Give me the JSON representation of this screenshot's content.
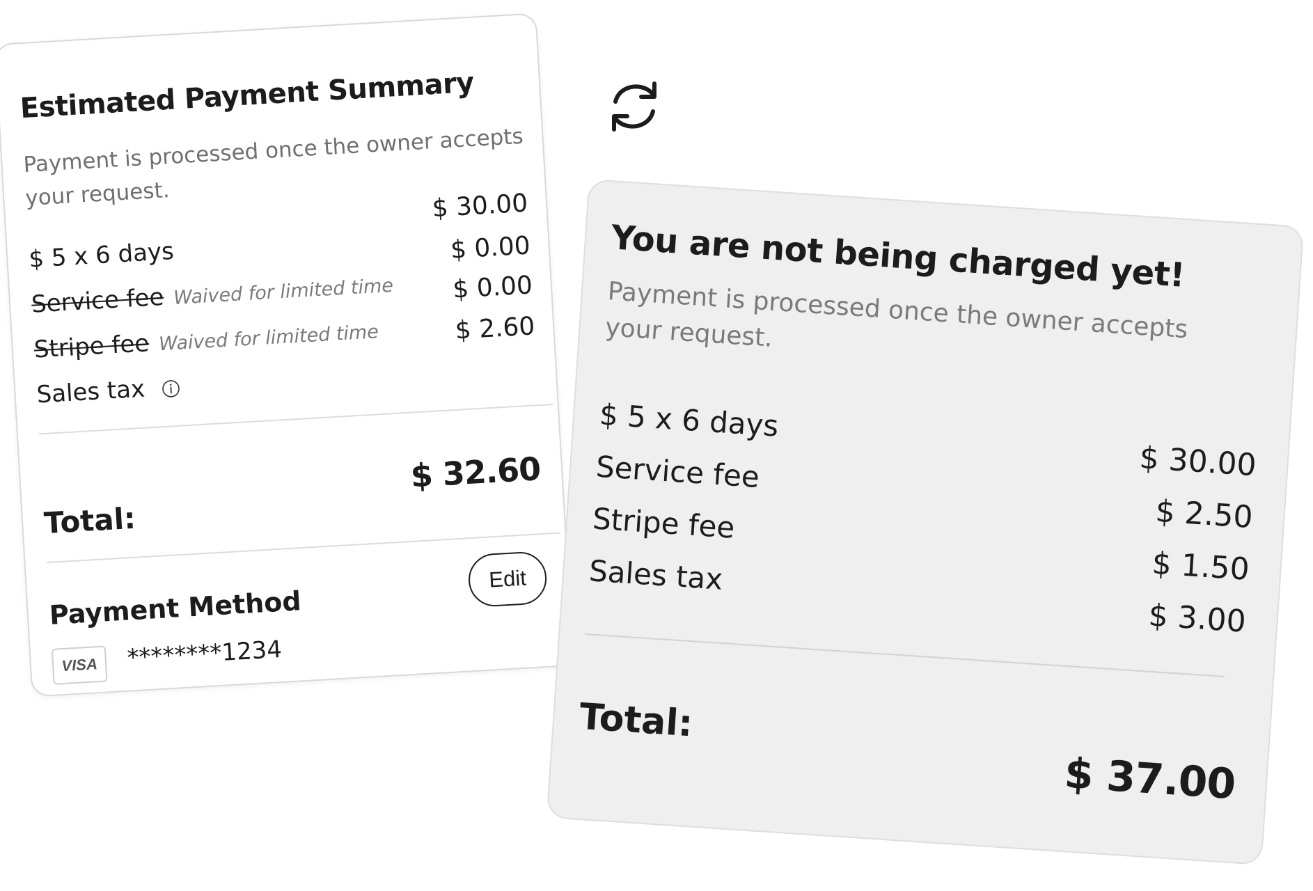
{
  "estimate_card": {
    "title": "Estimated Payment Summary",
    "subtitle": "Payment is processed once the owner accepts your request.",
    "rows": [
      {
        "label": "$ 5 x 6 days",
        "note": "",
        "amount": "$ 30.00",
        "struck": false
      },
      {
        "label": "Service fee",
        "note": "Waived for limited time",
        "amount": "$ 0.00",
        "struck": true
      },
      {
        "label": "Stripe fee",
        "note": "Waived for limited time",
        "amount": "$ 0.00",
        "struck": true
      },
      {
        "label": "Sales tax",
        "note": "",
        "amount": "$ 2.60",
        "struck": false
      }
    ],
    "total_label": "Total:",
    "total_amount": "$ 32.60",
    "payment_method_title": "Payment Method",
    "edit_label": "Edit",
    "card_brand": "VISA",
    "card_number": "********1234",
    "icons": {
      "sales_tax_info": "info-icon"
    }
  },
  "swap_icon": "refresh-icon",
  "charge_card": {
    "title": "You are not being charged yet!",
    "subtitle": "Payment is processed once the owner accepts your request.",
    "labels": [
      "$ 5 x 6 days",
      "Service fee",
      "Stripe fee",
      "Sales tax"
    ],
    "amounts": [
      "$ 30.00",
      "$ 2.50",
      "$ 1.50",
      "$ 3.00"
    ],
    "total_label": "Total:",
    "total_amount": "$ 37.00"
  },
  "colors": {
    "text": "#1c1c1c",
    "muted": "#6f6f6f",
    "grey_card_bg": "#efefef",
    "white_card_bg": "#ffffff"
  }
}
